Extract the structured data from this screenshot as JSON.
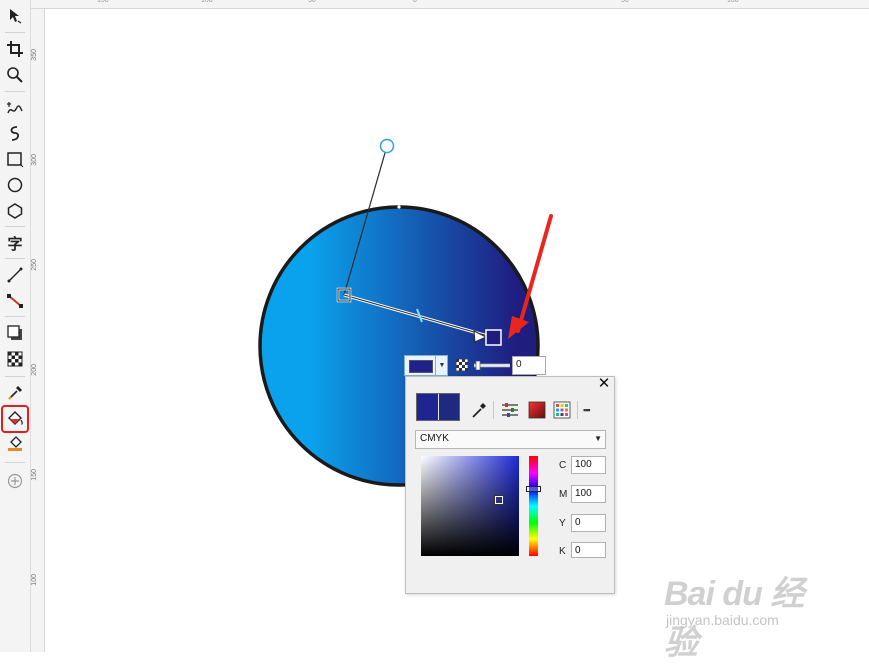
{
  "toolbox": {
    "tools": [
      {
        "name": "pick-tool",
        "icon": "pointer-icon"
      },
      {
        "name": "crop-tool",
        "icon": "crop-icon"
      },
      {
        "name": "zoom-tool",
        "icon": "zoom-icon"
      },
      {
        "name": "freehand-tool",
        "icon": "freehand-icon"
      },
      {
        "name": "artistic-media-tool",
        "icon": "brush-curve-icon"
      },
      {
        "name": "rectangle-tool",
        "icon": "rectangle-icon"
      },
      {
        "name": "ellipse-tool",
        "icon": "ellipse-icon"
      },
      {
        "name": "polygon-tool",
        "icon": "polygon-icon"
      },
      {
        "name": "text-tool",
        "icon": "text-icon",
        "glyph": "字"
      },
      {
        "name": "connector-tool",
        "icon": "line-icon"
      },
      {
        "name": "blend-tool",
        "icon": "blend-icon"
      },
      {
        "name": "drop-shadow-tool",
        "icon": "shadow-icon"
      },
      {
        "name": "transparency-tool",
        "icon": "checker-icon"
      },
      {
        "name": "eyedropper-tool",
        "icon": "eyedropper-icon"
      },
      {
        "name": "interactive-fill-tool",
        "icon": "fill-bucket-icon",
        "selected": true
      },
      {
        "name": "smart-fill-tool",
        "icon": "smart-fill-icon"
      },
      {
        "name": "add-tool",
        "icon": "plus-circle-icon"
      }
    ]
  },
  "rulers": {
    "left_labels": [
      "350",
      "300",
      "250",
      "200",
      "150",
      "100"
    ],
    "top_labels": [
      "150",
      "100",
      "50",
      "0",
      "50",
      "100"
    ]
  },
  "canvas": {
    "gradient_start_color": "#0aa2ec",
    "gradient_end_color": "#1f1d80",
    "outline_color": "#1a1a1a",
    "arrow_color": "#e8261e"
  },
  "fill_property_bar": {
    "node_color": "#1f228c",
    "transparency_value": "0"
  },
  "color_panel": {
    "close_glyph": "✕",
    "current_color_left": "#1f2590",
    "current_color_right": "#1d2a80",
    "model": "CMYK",
    "model_arrow": "▼",
    "channels": [
      {
        "label": "C",
        "value": "100"
      },
      {
        "label": "M",
        "value": "100"
      },
      {
        "label": "Y",
        "value": "0"
      },
      {
        "label": "K",
        "value": "0"
      }
    ],
    "more_glyph": "▪▪▪"
  },
  "watermark": {
    "brand": "Bai du 经验",
    "url": "jingyan.baidu.com"
  }
}
